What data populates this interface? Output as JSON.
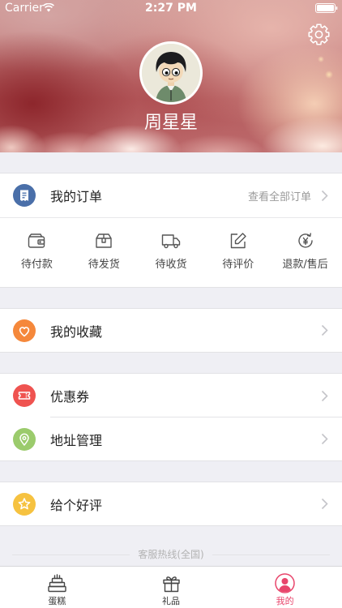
{
  "status_bar": {
    "carrier": "Carrier",
    "time": "2:27 PM",
    "wifi_icon": "wifi-icon",
    "battery_icon": "battery-icon"
  },
  "header": {
    "settings_icon": "gear-icon",
    "user_name": "周星星"
  },
  "orders": {
    "icon": "order-list-icon",
    "color": "#4a6fa9",
    "title": "我的订单",
    "view_all": "查看全部订单",
    "statuses": [
      {
        "label": "待付款",
        "icon": "wallet-icon"
      },
      {
        "label": "待发货",
        "icon": "package-icon"
      },
      {
        "label": "待收货",
        "icon": "truck-icon"
      },
      {
        "label": "待评价",
        "icon": "edit-icon"
      },
      {
        "label": "退款/售后",
        "icon": "refund-icon"
      }
    ]
  },
  "menu": {
    "favorites": {
      "label": "我的收藏",
      "icon": "heart-icon",
      "color": "#f5883b"
    },
    "coupons": {
      "label": "优惠券",
      "icon": "ticket-icon",
      "color": "#ef5350"
    },
    "address": {
      "label": "地址管理",
      "icon": "location-pin-icon",
      "color": "#9bcb6c"
    },
    "review": {
      "label": "给个好评",
      "icon": "star-icon",
      "color": "#f6c240"
    }
  },
  "footer": {
    "hotline_label": "客服热线(全国)"
  },
  "tabbar": {
    "tabs": [
      {
        "label": "蛋糕",
        "icon": "cake-icon",
        "active": false
      },
      {
        "label": "礼品",
        "icon": "gift-icon",
        "active": false
      },
      {
        "label": "我的",
        "icon": "user-icon",
        "active": true
      }
    ]
  },
  "colors": {
    "page_background": "#efeff4",
    "accent": "#e8456b",
    "text_primary": "#222222",
    "text_secondary": "#999999",
    "chevron": "#c4c4c9"
  }
}
